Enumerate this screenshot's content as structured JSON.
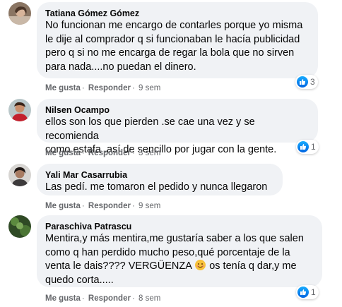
{
  "comments": [
    {
      "author": "Tatiana Gómez Gómez",
      "text": "No funcionan me encargo de contarles porque yo misma\nle dije al comprador q si funcionaban le hacía publicidad\npero q si no me encarga de regar la bola que no sirven\npara nada....no puedan el dinero.",
      "like": "Me gusta",
      "reply": "Responder",
      "time": "9 sem",
      "reaction_count": "3"
    },
    {
      "author": "Nilsen Ocampo",
      "text": "ellos son los que pierden .se cae una vez y se recomienda\ncomo estafa .así de sencillo por jugar con la gente.",
      "like": "Me gusta",
      "reply": "Responder",
      "time": "3 sem",
      "reaction_count": "1"
    },
    {
      "author": "Yali Mar Casarrubia",
      "text": "Las pedí. me tomaron el pedido y nunca llegaron",
      "like": "Me gusta",
      "reply": "Responder",
      "time": "9 sem"
    },
    {
      "author": "Paraschiva Patrascu",
      "text_before_emoji": "Mentira,y más mentira,me gustaría saber a los que salen\ncomo q han perdido mucho peso,qué porcentaje de la\nventa le dais???? VERGÜENZA ",
      "text_after_emoji": " os tenía q dar,y me\nquedo corta.....",
      "like": "Me gusta",
      "reply": "Responder",
      "time": "8 sem",
      "reaction_count": "1"
    }
  ],
  "separator": "·",
  "colors": {
    "bubble": "#f0f2f5",
    "meta": "#65676b",
    "like_blue": "#0866ff"
  },
  "icons": {
    "reaction": "like-thumb-icon",
    "emoji": "smiling-face-icon"
  }
}
